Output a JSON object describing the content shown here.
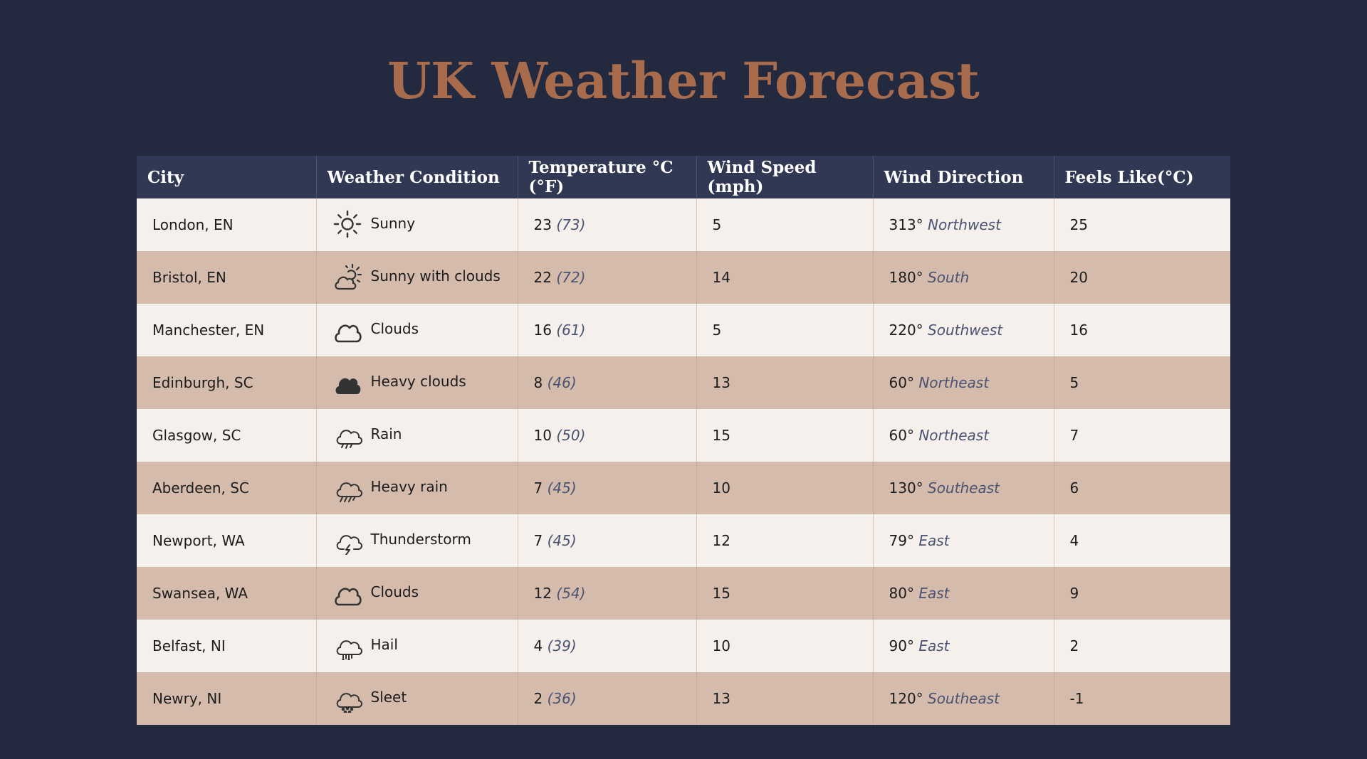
{
  "title": "UK Weather Forecast",
  "columns": [
    "City",
    "Weather Condition",
    "Temperature °C (°F)",
    "Wind Speed (mph)",
    "Wind Direction",
    "Feels Like(°C)"
  ],
  "rows": [
    {
      "city": "London, EN",
      "icon": "sun-icon",
      "condition": "Sunny",
      "temp_c": "23",
      "temp_f": "(73)",
      "wind_speed": "5",
      "wind_deg": "313°",
      "wind_dir": "Northwest",
      "feels_like": "25"
    },
    {
      "city": "Bristol, EN",
      "icon": "sun-cloud-icon",
      "condition": "Sunny with clouds",
      "temp_c": "22",
      "temp_f": "(72)",
      "wind_speed": "14",
      "wind_deg": "180°",
      "wind_dir": "South",
      "feels_like": "20"
    },
    {
      "city": "Manchester, EN",
      "icon": "cloud-icon",
      "condition": "Clouds",
      "temp_c": "16",
      "temp_f": "(61)",
      "wind_speed": "5",
      "wind_deg": "220°",
      "wind_dir": "Southwest",
      "feels_like": "16"
    },
    {
      "city": "Edinburgh, SC",
      "icon": "heavy-cloud-icon",
      "condition": "Heavy clouds",
      "temp_c": "8",
      "temp_f": "(46)",
      "wind_speed": "13",
      "wind_deg": "60°",
      "wind_dir": "Northeast",
      "feels_like": "5"
    },
    {
      "city": "Glasgow, SC",
      "icon": "rain-icon",
      "condition": "Rain",
      "temp_c": "10",
      "temp_f": "(50)",
      "wind_speed": "15",
      "wind_deg": "60°",
      "wind_dir": "Northeast",
      "feels_like": "7"
    },
    {
      "city": "Aberdeen, SC",
      "icon": "heavy-rain-icon",
      "condition": "Heavy rain",
      "temp_c": "7",
      "temp_f": "(45)",
      "wind_speed": "10",
      "wind_deg": "130°",
      "wind_dir": "Southeast",
      "feels_like": "6"
    },
    {
      "city": "Newport, WA",
      "icon": "thunderstorm-icon",
      "condition": "Thunderstorm",
      "temp_c": "7",
      "temp_f": "(45)",
      "wind_speed": "12",
      "wind_deg": "79°",
      "wind_dir": "East",
      "feels_like": "4"
    },
    {
      "city": "Swansea, WA",
      "icon": "cloud-icon",
      "condition": "Clouds",
      "temp_c": "12",
      "temp_f": "(54)",
      "wind_speed": "15",
      "wind_deg": "80°",
      "wind_dir": "East",
      "feels_like": "9"
    },
    {
      "city": "Belfast, NI",
      "icon": "hail-icon",
      "condition": "Hail",
      "temp_c": "4",
      "temp_f": "(39)",
      "wind_speed": "10",
      "wind_deg": "90°",
      "wind_dir": "East",
      "feels_like": "2"
    },
    {
      "city": "Newry, NI",
      "icon": "sleet-icon",
      "condition": "Sleet",
      "temp_c": "2",
      "temp_f": "(36)",
      "wind_speed": "13",
      "wind_deg": "120°",
      "wind_dir": "Southeast",
      "feels_like": "-1"
    }
  ],
  "colors": {
    "background": "#232a40",
    "title": "#a86c4c",
    "header": "#303853",
    "row_light": "#f5f0ec",
    "row_dark": "#d5bbac",
    "muted_text": "#4a5372"
  }
}
